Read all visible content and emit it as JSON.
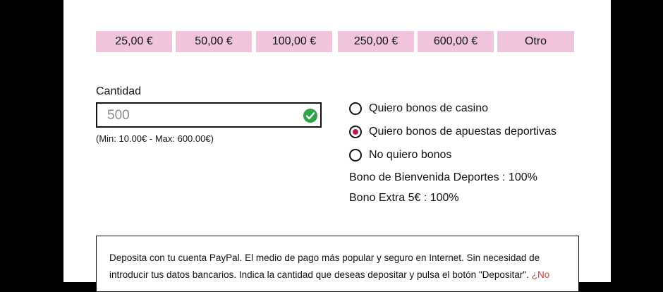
{
  "amount_options": [
    "25,00 €",
    "50,00 €",
    "100,00 €",
    "250,00 €",
    "600,00 €",
    "Otro"
  ],
  "amount_field": {
    "label": "Cantidad",
    "value": "500",
    "limits": "(Min: 10.00€  -  Max: 600.00€)",
    "valid_icon": "check-circle-icon",
    "valid_color": "#2fa34a"
  },
  "bonus_options": [
    {
      "label": "Quiero bonos de casino",
      "selected": false
    },
    {
      "label": "Quiero bonos de apuestas deportivas",
      "selected": true
    },
    {
      "label": "No quiero bonos",
      "selected": false
    }
  ],
  "bonus_details": [
    "Bono de Bienvenida Deportes : 100%",
    "Bono Extra 5€ : 100%"
  ],
  "info": {
    "text": "Deposita con tu cuenta PayPal. El medio de pago más popular y seguro en Internet. Sin necesidad de introducir tus datos bancarios. Indica la cantidad que deseas depositar y pulsa el botón \"Depositar\". ",
    "link": "¿No"
  },
  "colors": {
    "accent": "#f0c4dc",
    "selected_radio": "#c2185b",
    "link": "#e53935"
  }
}
